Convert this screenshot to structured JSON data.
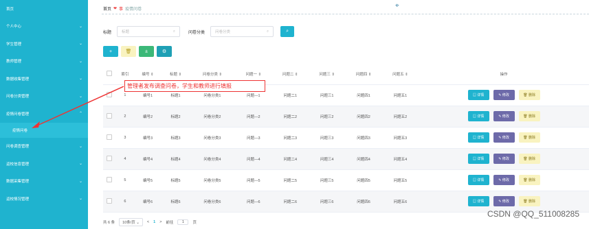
{
  "sidebar": {
    "items": [
      {
        "label": "首页",
        "chev": ""
      },
      {
        "label": "个人中心",
        "chev": "⌄"
      },
      {
        "label": "学生管理",
        "chev": "⌄"
      },
      {
        "label": "教师管理",
        "chev": "⌄"
      },
      {
        "label": "数据收集管理",
        "chev": "⌄"
      },
      {
        "label": "问卷分类管理",
        "chev": "⌄"
      },
      {
        "label": "疫情问卷管理",
        "chev": "⌃"
      }
    ],
    "sub_item": "疫情问卷",
    "items_after": [
      {
        "label": "问卷调查管理",
        "chev": "⌄"
      },
      {
        "label": "返校信息管理",
        "chev": "⌄"
      },
      {
        "label": "数据采集管理",
        "chev": "⌄"
      },
      {
        "label": "返校情况管理",
        "chev": "⌄"
      }
    ]
  },
  "breadcrumb": {
    "home": "首页",
    "sep": "❤",
    "current": "疫情问卷"
  },
  "filters": {
    "title_label": "标题",
    "title_placeholder": "标题",
    "category_label": "问卷分类",
    "category_placeholder": "问卷分类"
  },
  "toolbar": {
    "add": "+",
    "delete": "🗑",
    "stat1": "±",
    "stat2": "⚙"
  },
  "table": {
    "headers": [
      "索引",
      "编号 ⇕",
      "标题 ⇕",
      "问卷分类 ⇕",
      "问题一 ⇕",
      "问题二 ⇕",
      "问题三 ⇕",
      "问题四 ⇕",
      "问题五 ⇕",
      "操作"
    ],
    "rows": [
      [
        "1",
        "编号1",
        "标题1",
        "问卷分类1",
        "问题—1",
        "问题二1",
        "问题三1",
        "问题四1",
        "问题五1"
      ],
      [
        "2",
        "编号2",
        "标题2",
        "问卷分类2",
        "问题—2",
        "问题二2",
        "问题三2",
        "问题四2",
        "问题五2"
      ],
      [
        "3",
        "编号3",
        "标题3",
        "问卷分类3",
        "问题—3",
        "问题二3",
        "问题三3",
        "问题四3",
        "问题五3"
      ],
      [
        "4",
        "编号4",
        "标题4",
        "问卷分类4",
        "问题—4",
        "问题二4",
        "问题三4",
        "问题四4",
        "问题五4"
      ],
      [
        "5",
        "编号5",
        "标题5",
        "问卷分类5",
        "问题—5",
        "问题二5",
        "问题三5",
        "问题四5",
        "问题五5"
      ],
      [
        "6",
        "编号6",
        "标题6",
        "问卷分类6",
        "问题—6",
        "问题二6",
        "问题三6",
        "问题四6",
        "问题五6"
      ]
    ],
    "ops": {
      "detail": "▤ 详情",
      "edit": "✎ 修改",
      "remove": "🗑 删除"
    }
  },
  "pager": {
    "total": "共 6 条",
    "page_size": "10条/页 ⌄",
    "prev": "<",
    "current": "1",
    "next": ">",
    "goto_label": "前往",
    "goto_value": "1",
    "page_unit": "页"
  },
  "annotation": "管理者发布调查问卷，学生和教师进行填报",
  "watermark": "CSDN @QQ_511008285",
  "colors": {
    "accent": "#1fb3cf",
    "edit": "#6d6aa9",
    "remove": "#f9f3c0",
    "annotation": "#e33333"
  }
}
